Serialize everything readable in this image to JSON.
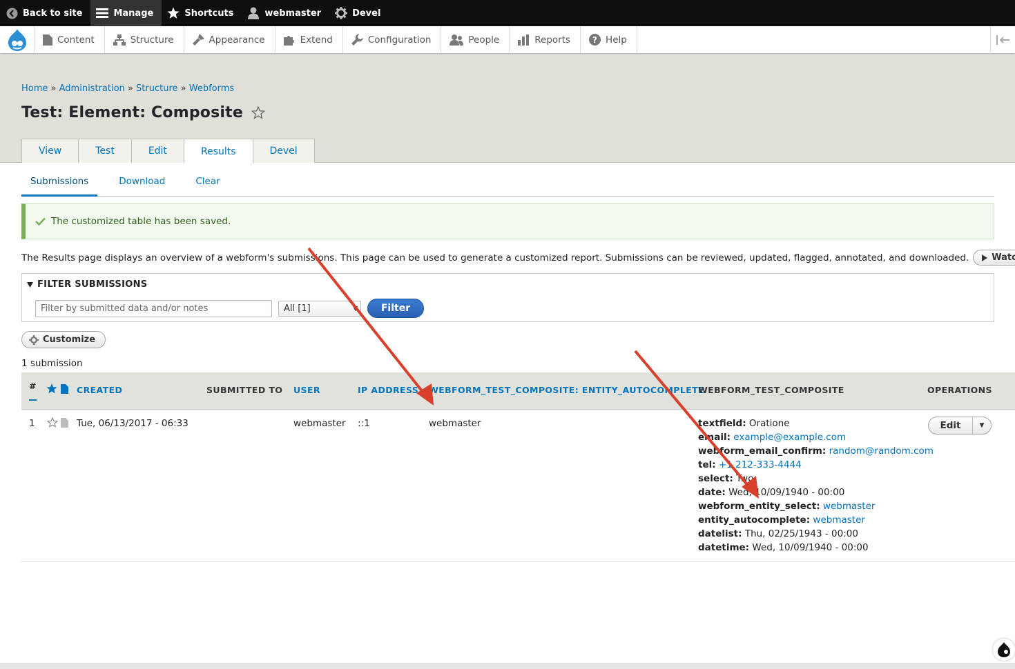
{
  "toolbar": {
    "back": "Back to site",
    "manage": "Manage",
    "shortcuts": "Shortcuts",
    "user": "webmaster",
    "devel": "Devel"
  },
  "tray": {
    "items": [
      "Content",
      "Structure",
      "Appearance",
      "Extend",
      "Configuration",
      "People",
      "Reports",
      "Help"
    ]
  },
  "breadcrumb": {
    "items": [
      "Home",
      "Administration",
      "Structure",
      "Webforms"
    ],
    "sep": "»"
  },
  "page": {
    "title": "Test: Element: Composite"
  },
  "tabs": [
    "View",
    "Test",
    "Edit",
    "Results",
    "Devel"
  ],
  "subtabs": [
    "Submissions",
    "Download",
    "Clear"
  ],
  "message": "The customized table has been saved.",
  "description": "The Results page displays an overview of a webform's submissions. This page can be used to generate a customized report. Submissions can be reviewed, updated, flagged, annotated, and downloaded.",
  "watch_video": "Watch video",
  "filter": {
    "legend": "FILTER SUBMISSIONS",
    "placeholder": "Filter by submitted data and/or notes",
    "select_value": "All [1]",
    "button": "Filter"
  },
  "customize": "Customize",
  "count": "1 submission",
  "table": {
    "headers": {
      "num": "#",
      "created": "CREATED",
      "submitted_to": "SUBMITTED TO",
      "user": "USER",
      "ip": "IP ADDRESS",
      "entity_autocomplete": "WEBFORM_TEST_COMPOSITE: ENTITY_AUTOCOMPLETE",
      "composite": "WEBFORM_TEST_COMPOSITE",
      "operations": "OPERATIONS"
    },
    "row": {
      "num": "1",
      "created": "Tue, 06/13/2017 - 06:33",
      "user": "webmaster",
      "ip": "::1",
      "entity_autocomplete": "webmaster",
      "composite": [
        {
          "key": "textfield:",
          "value": "Oratione",
          "link": false
        },
        {
          "key": "email:",
          "value": "example@example.com",
          "link": true
        },
        {
          "key": "webform_email_confirm:",
          "value": "random@random.com",
          "link": true
        },
        {
          "key": "tel:",
          "value": "+1 212-333-4444",
          "link": true
        },
        {
          "key": "select:",
          "value": "Two",
          "link": false
        },
        {
          "key": "date:",
          "value": "Wed, 10/09/1940 - 00:00",
          "link": false
        },
        {
          "key": "webform_entity_select:",
          "value": "webmaster",
          "link": true
        },
        {
          "key": "entity_autocomplete:",
          "value": "webmaster",
          "link": true
        },
        {
          "key": "datelist:",
          "value": "Thu, 02/25/1943 - 00:00",
          "link": false
        },
        {
          "key": "datetime:",
          "value": "Wed, 10/09/1940 - 00:00",
          "link": false
        }
      ],
      "edit": "Edit"
    }
  },
  "colors": {
    "link": "#0074bd",
    "arrow": "#d9402b",
    "success": "#77b259"
  }
}
